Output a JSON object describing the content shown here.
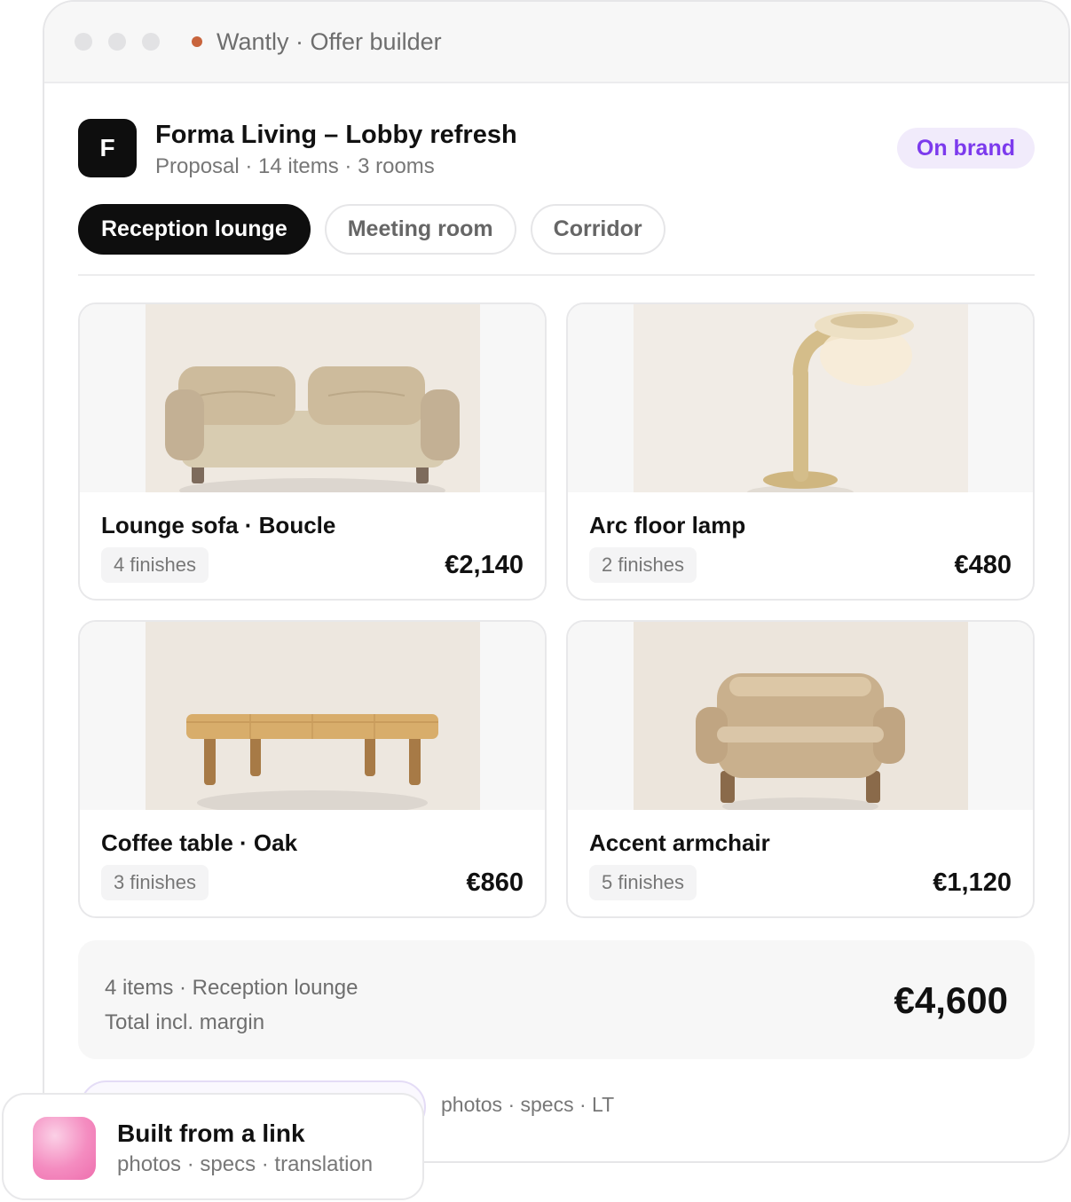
{
  "window": {
    "title": "Wantly · Offer builder",
    "status_color": "#c8643c"
  },
  "project": {
    "logo_letter": "F",
    "title": "Forma Living – Lobby refresh",
    "subtitle": "Proposal · 14 items · 3 rooms",
    "badge": "On brand",
    "badge_color": "#7c3aed"
  },
  "tabs": [
    {
      "label": "Reception lounge",
      "active": true
    },
    {
      "label": "Meeting room",
      "active": false
    },
    {
      "label": "Corridor",
      "active": false
    }
  ],
  "products": [
    {
      "name": "Lounge sofa · Boucle",
      "finishes": "4 finishes",
      "price": "€2,140",
      "icon": "sofa-illustration"
    },
    {
      "name": "Arc floor lamp",
      "finishes": "2 finishes",
      "price": "€480",
      "icon": "floor-lamp-illustration"
    },
    {
      "name": "Coffee table · Oak",
      "finishes": "3 finishes",
      "price": "€860",
      "icon": "coffee-table-illustration"
    },
    {
      "name": "Accent armchair",
      "finishes": "5 finishes",
      "price": "€1,120",
      "icon": "armchair-illustration"
    }
  ],
  "summary": {
    "line1": "4 items · Reception lounge",
    "line2": "Total incl. margin",
    "total": "€4,600"
  },
  "footer_peek": {
    "text": "photos · specs · LT"
  },
  "toast": {
    "title": "Built from a link",
    "subtitle": "photos · specs · translation"
  }
}
